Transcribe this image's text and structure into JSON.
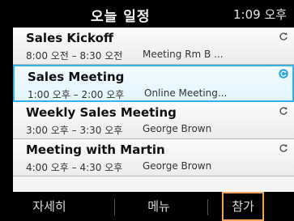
{
  "header": {
    "title": "오늘 일정",
    "clock": "1:09 오후"
  },
  "meetings": [
    {
      "title": "Sales Kickoff",
      "time": "8:00 오전 – 8:30 오전",
      "location": "Meeting Rm B ...",
      "icon": "recurring-arrow-icon",
      "selected": false
    },
    {
      "title": "Sales Meeting",
      "time": "1:00 오후 – 2:00 오후",
      "location": "Online Meeting...",
      "icon": "recurring-circle-icon",
      "selected": true
    },
    {
      "title": "Weekly Sales Meeting",
      "time": "3:00 오후 – 3:30 오후",
      "location": "George Brown",
      "icon": "recurring-arrow-icon",
      "selected": false
    },
    {
      "title": "Meeting with Martin",
      "time": "4:00 오후 – 4:30 오후",
      "location": "George Brown",
      "icon": "recurring-arrow-icon",
      "selected": false
    }
  ],
  "softkeys": {
    "left": "자세히",
    "middle": "메뉴",
    "right": "참가"
  },
  "colors": {
    "selection": "#35b3ea",
    "softkey_highlight": "#f5a35a"
  }
}
